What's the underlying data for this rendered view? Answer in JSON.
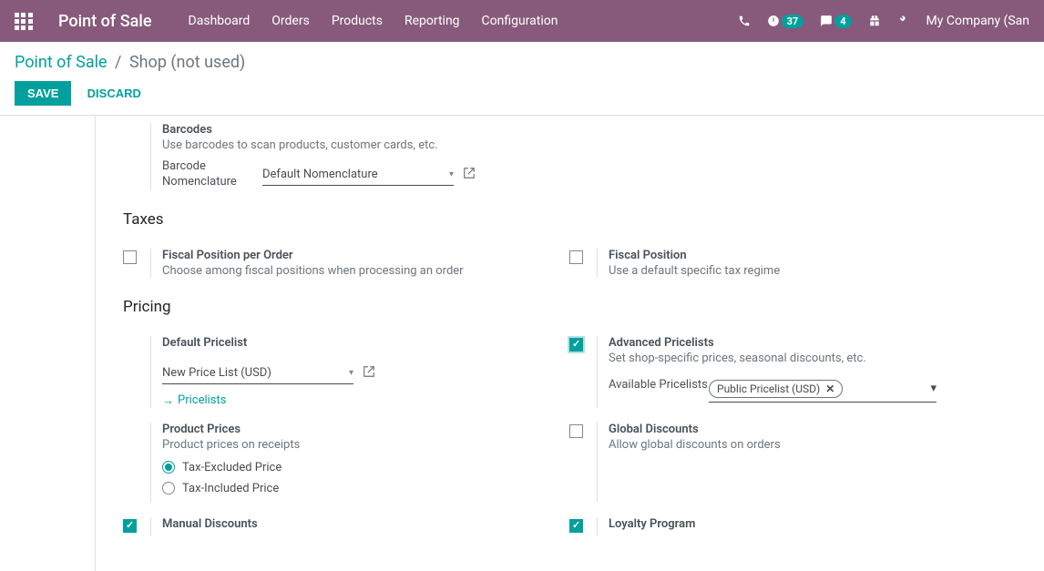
{
  "topbar": {
    "brand": "Point of Sale",
    "menu": [
      "Dashboard",
      "Orders",
      "Products",
      "Reporting",
      "Configuration"
    ],
    "activities_count": "37",
    "messages_count": "4",
    "company": "My Company (San "
  },
  "breadcrumb": {
    "root": "Point of Sale",
    "current": "Shop (not used)"
  },
  "actions": {
    "save": "SAVE",
    "discard": "DISCARD"
  },
  "barcodes": {
    "title": "Barcodes",
    "desc": "Use barcodes to scan products, customer cards, etc.",
    "field_label": "Barcode Nomenclature",
    "value": "Default Nomenclature"
  },
  "taxes": {
    "title": "Taxes",
    "fiscal_per_order": {
      "label": "Fiscal Position per Order",
      "desc": "Choose among fiscal positions when processing an order"
    },
    "fiscal_position": {
      "label": "Fiscal Position",
      "desc": "Use a default specific tax regime"
    }
  },
  "pricing": {
    "title": "Pricing",
    "default_pricelist": {
      "label": "Default Pricelist",
      "value": "New Price List (USD)",
      "link": "Pricelists"
    },
    "advanced_pricelists": {
      "label": "Advanced Pricelists",
      "desc": "Set shop-specific prices, seasonal discounts, etc.",
      "field_label": "Available Pricelists",
      "tag": "Public Pricelist (USD)"
    },
    "product_prices": {
      "label": "Product Prices",
      "desc": "Product prices on receipts",
      "opt1": "Tax-Excluded Price",
      "opt2": "Tax-Included Price"
    },
    "global_discounts": {
      "label": "Global Discounts",
      "desc": "Allow global discounts on orders"
    },
    "manual_discounts": {
      "label": "Manual Discounts"
    },
    "loyalty": {
      "label": "Loyalty Program"
    }
  }
}
